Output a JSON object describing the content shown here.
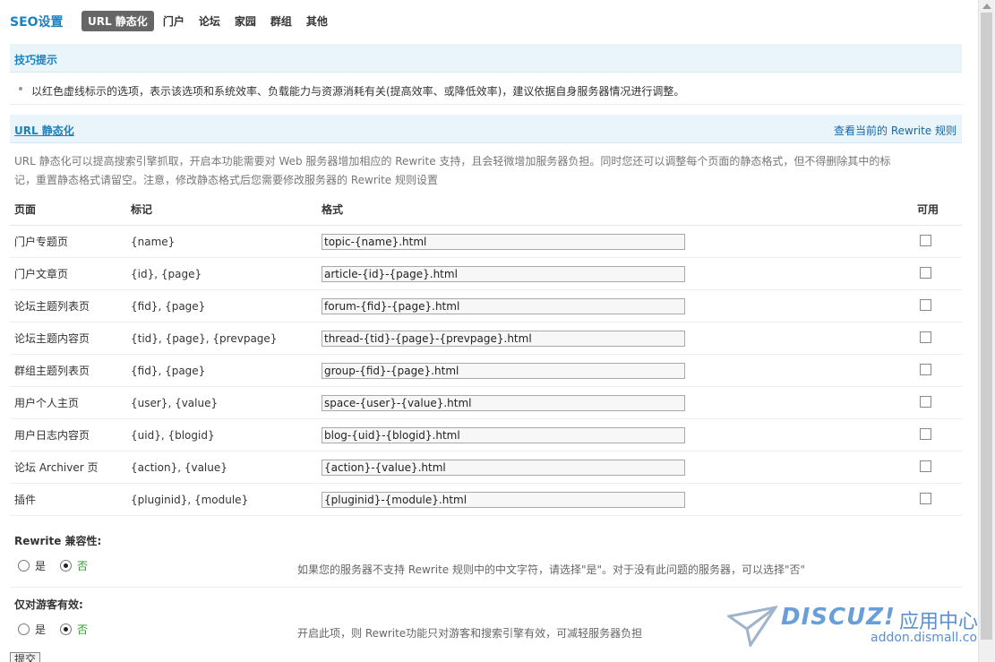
{
  "header": {
    "title": "SEO设置",
    "tabs": [
      {
        "label": "URL 静态化",
        "active": true
      },
      {
        "label": "门户",
        "active": false
      },
      {
        "label": "论坛",
        "active": false
      },
      {
        "label": "家园",
        "active": false
      },
      {
        "label": "群组",
        "active": false
      },
      {
        "label": "其他",
        "active": false
      }
    ]
  },
  "tips": {
    "heading": "技巧提示",
    "text": "以红色虚线标示的选项，表示该选项和系统效率、负载能力与资源消耗有关(提高效率、或降低效率)，建议依据自身服务器情况进行调整。"
  },
  "url_static": {
    "heading": "URL 静态化",
    "rewrite_link": "查看当前的 Rewrite 规则",
    "description": "URL 静态化可以提高搜索引擎抓取，开启本功能需要对 Web 服务器增加相应的 Rewrite 支持，且会轻微增加服务器负担。同时您还可以调整每个页面的静态格式，但不得删除其中的标记，重置静态格式请留空。注意，修改静态格式后您需要修改服务器的 Rewrite 规则设置",
    "columns": {
      "page": "页面",
      "mark": "标记",
      "format": "格式",
      "enabled": "可用"
    },
    "rows": [
      {
        "page": "门户专题页",
        "mark": "{name}",
        "format": "topic-{name}.html",
        "enabled": false
      },
      {
        "page": "门户文章页",
        "mark": "{id}, {page}",
        "format": "article-{id}-{page}.html",
        "enabled": false
      },
      {
        "page": "论坛主题列表页",
        "mark": "{fid}, {page}",
        "format": "forum-{fid}-{page}.html",
        "enabled": false
      },
      {
        "page": "论坛主题内容页",
        "mark": "{tid}, {page}, {prevpage}",
        "format": "thread-{tid}-{page}-{prevpage}.html",
        "enabled": false
      },
      {
        "page": "群组主题列表页",
        "mark": "{fid}, {page}",
        "format": "group-{fid}-{page}.html",
        "enabled": false
      },
      {
        "page": "用户个人主页",
        "mark": "{user}, {value}",
        "format": "space-{user}-{value}.html",
        "enabled": false
      },
      {
        "page": "用户日志内容页",
        "mark": "{uid}, {blogid}",
        "format": "blog-{uid}-{blogid}.html",
        "enabled": false
      },
      {
        "page": "论坛 Archiver 页",
        "mark": "{action}, {value}",
        "format": "{action}-{value}.html",
        "enabled": false
      },
      {
        "page": "插件",
        "mark": "{pluginid}, {module}",
        "format": "{pluginid}-{module}.html",
        "enabled": false
      }
    ]
  },
  "rewrite_compat": {
    "label": "Rewrite 兼容性:",
    "yes": "是",
    "no": "否",
    "selected": "no",
    "hint": "如果您的服务器不支持 Rewrite 规则中的中文字符，请选择\"是\"。对于没有此问题的服务器，可以选择\"否\""
  },
  "guest_only": {
    "label": "仅对游客有效:",
    "yes": "是",
    "no": "否",
    "selected": "no",
    "hint": "开启此项，则 Rewrite功能只对游客和搜索引擎有效，可减轻服务器负担"
  },
  "submit_label": "提交",
  "watermark": {
    "logo": "DISCUZ!",
    "cn": "应用中心",
    "url": "addon.dismall.com"
  },
  "colors": {
    "accent": "#1a82c0",
    "tab_active_bg": "#666666",
    "section_bg": "#eaf4fb"
  }
}
